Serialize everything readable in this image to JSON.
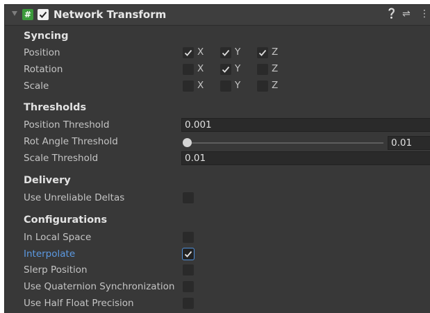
{
  "header": {
    "title": "Network Transform",
    "enabled": true
  },
  "syncing": {
    "title": "Syncing",
    "rows": [
      {
        "label": "Position",
        "x": true,
        "y": true,
        "z": true
      },
      {
        "label": "Rotation",
        "x": false,
        "y": true,
        "z": false
      },
      {
        "label": "Scale",
        "x": false,
        "y": false,
        "z": false
      }
    ],
    "axis_labels": [
      "X",
      "Y",
      "Z"
    ]
  },
  "thresholds": {
    "title": "Thresholds",
    "position_label": "Position Threshold",
    "position_value": "0.001",
    "rot_label": "Rot Angle Threshold",
    "rot_value": "0.01",
    "rot_slider_fraction": 0.0,
    "scale_label": "Scale Threshold",
    "scale_value": "0.01"
  },
  "delivery": {
    "title": "Delivery",
    "unreliable_label": "Use Unreliable Deltas",
    "unreliable": false
  },
  "configurations": {
    "title": "Configurations",
    "local_space_label": "In Local Space",
    "local_space": false,
    "interpolate_label": "Interpolate",
    "interpolate": true,
    "slerp_label": "Slerp Position",
    "slerp": false,
    "quaternion_label": "Use Quaternion Synchronization",
    "quaternion": false,
    "half_float_label": "Use Half Float Precision",
    "half_float": false
  },
  "icons": [
    "foldout-arrow-icon",
    "script-icon",
    "help-icon",
    "preset-icon",
    "kebab-menu-icon"
  ]
}
